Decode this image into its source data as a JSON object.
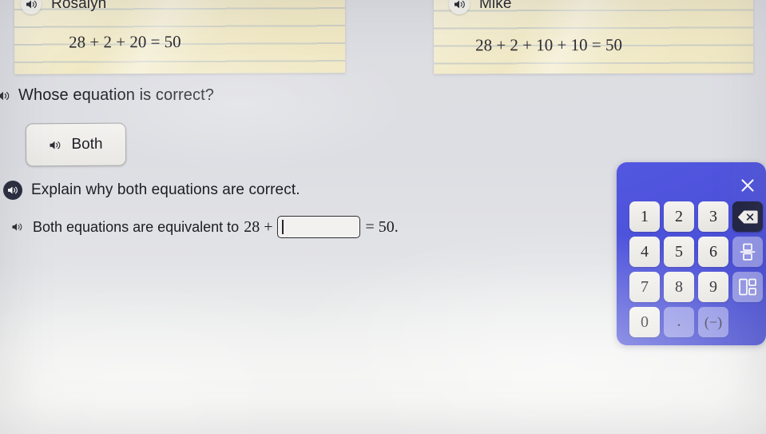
{
  "background_color": "#dcdde2",
  "cards": [
    {
      "name": "Rosalyn",
      "equation": "28 + 2 + 20 = 50",
      "speaker_icon": "speaker-icon"
    },
    {
      "name": "Mike",
      "equation": "28 + 2 + 10 + 10 = 50",
      "speaker_icon": "speaker-icon"
    }
  ],
  "question": {
    "speaker_icon": "speaker-icon",
    "text": "Whose equation is correct?",
    "answer_choice": {
      "label": "Both",
      "speaker_icon": "speaker-icon"
    }
  },
  "explain": {
    "speaker_icon": "speaker-icon",
    "text": "Explain why both equations are correct."
  },
  "answer": {
    "speaker_icon": "speaker-icon",
    "prefix": "Both equations are equivalent to",
    "math_lhs": "28 +",
    "input_value": "",
    "input_placeholder": "",
    "math_rhs": "= 50."
  },
  "keypad": {
    "panel_color": "#4c51da",
    "close_icon": "close-icon",
    "keys": [
      {
        "label": "1",
        "name": "key-1",
        "style": "num"
      },
      {
        "label": "2",
        "name": "key-2",
        "style": "num"
      },
      {
        "label": "3",
        "name": "key-3",
        "style": "num"
      },
      {
        "label": "",
        "name": "backspace-key",
        "style": "dark",
        "icon": "backspace-icon"
      },
      {
        "label": "4",
        "name": "key-4",
        "style": "num"
      },
      {
        "label": "5",
        "name": "key-5",
        "style": "num"
      },
      {
        "label": "6",
        "name": "key-6",
        "style": "num"
      },
      {
        "label": "",
        "name": "fraction-key",
        "style": "soft",
        "icon": "fraction-icon"
      },
      {
        "label": "7",
        "name": "key-7",
        "style": "num"
      },
      {
        "label": "8",
        "name": "key-8",
        "style": "num"
      },
      {
        "label": "9",
        "name": "key-9",
        "style": "num"
      },
      {
        "label": "",
        "name": "mixed-number-key",
        "style": "soft",
        "icon": "mixed-number-icon"
      },
      {
        "label": "0",
        "name": "key-0",
        "style": "num"
      },
      {
        "label": ".",
        "name": "decimal-key",
        "style": "soft-dot"
      },
      {
        "label": "(−)",
        "name": "negative-key",
        "style": "soft"
      },
      {
        "label": "",
        "name": "key-empty",
        "style": "none"
      }
    ]
  }
}
